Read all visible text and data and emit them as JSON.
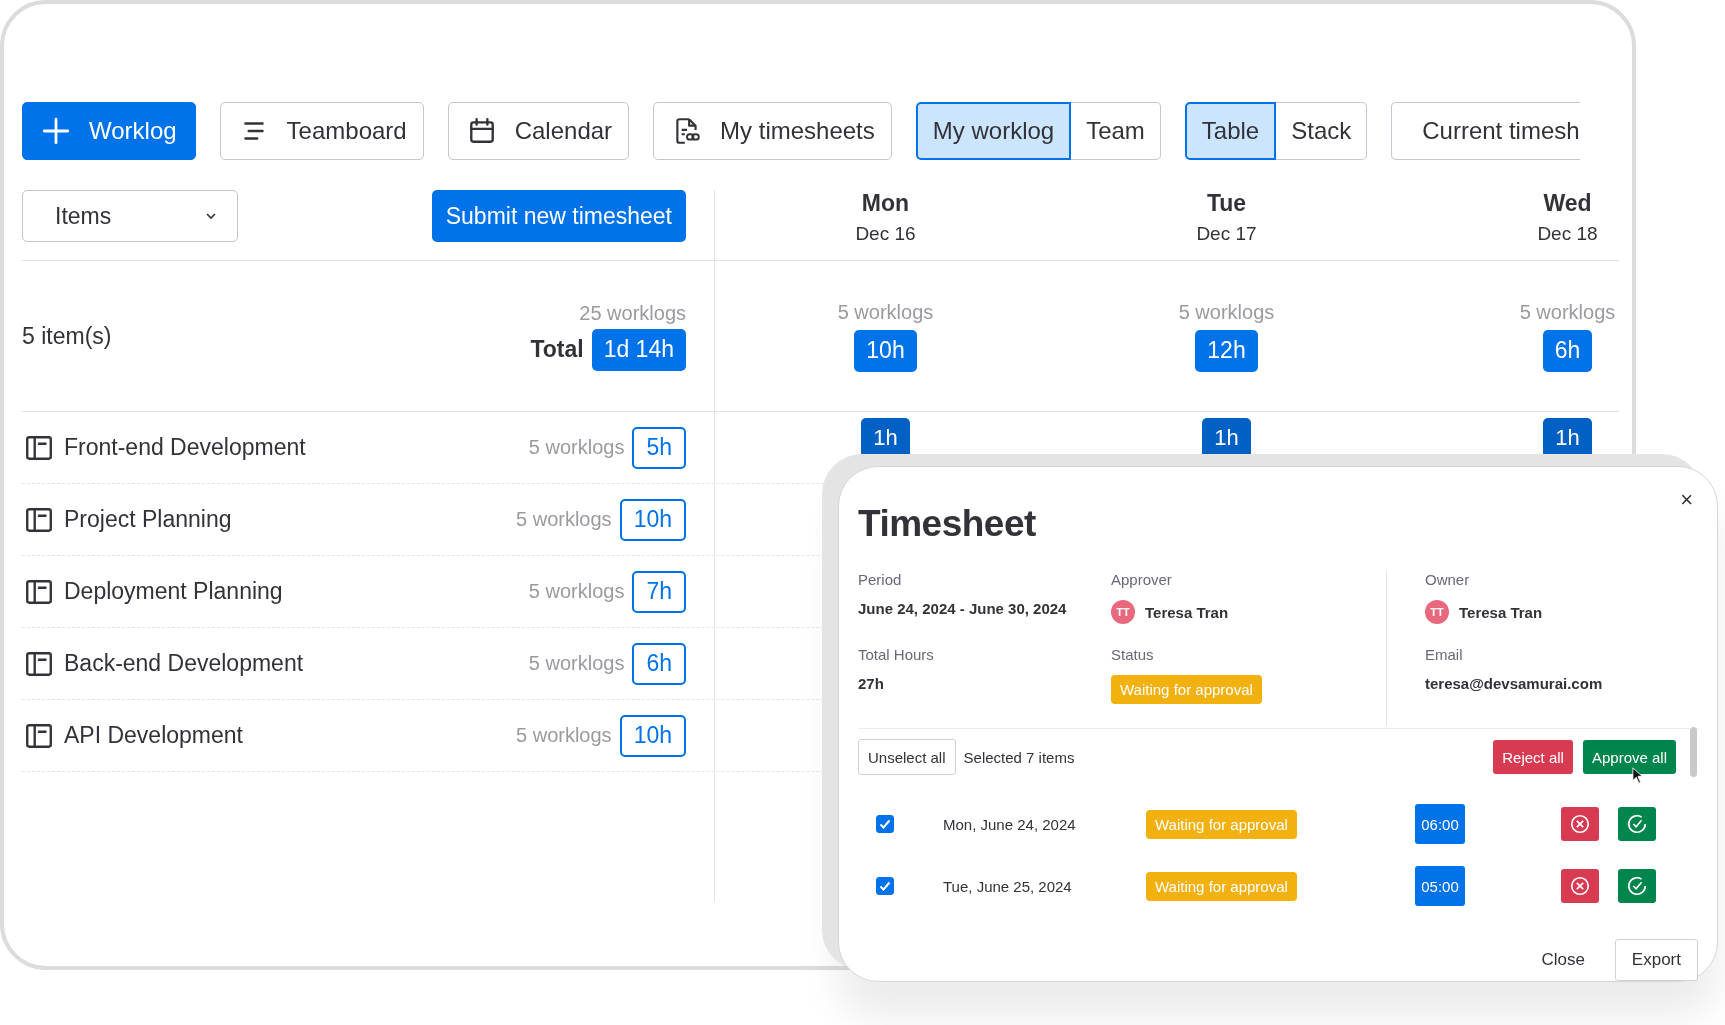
{
  "toolbar": {
    "buttons": [
      {
        "kind": "add",
        "label": "Worklog"
      },
      {
        "kind": "board",
        "label": "Teamboard"
      },
      {
        "kind": "calendar",
        "label": "Calendar"
      },
      {
        "kind": "sheets",
        "label": "My timesheets"
      }
    ],
    "scope_toggle": [
      {
        "label": "My worklog",
        "selected": true
      },
      {
        "label": "Team",
        "selected": false
      }
    ],
    "view_toggle": [
      {
        "label": "Table",
        "selected": true
      },
      {
        "label": "Stack",
        "selected": false
      }
    ],
    "period_button": "Current timesh"
  },
  "group_by": {
    "value": "Items"
  },
  "submit_button": "Submit new timesheet",
  "days": [
    {
      "day": "Mon",
      "date": "Dec 16",
      "worklogs": "5 worklogs",
      "total": "10h"
    },
    {
      "day": "Tue",
      "date": "Dec 17",
      "worklogs": "5 worklogs",
      "total": "12h"
    },
    {
      "day": "Wed",
      "date": "Dec 18",
      "worklogs": "5 worklogs",
      "total": "6h"
    }
  ],
  "summary": {
    "count": "5 item(s)",
    "worklogs": "25 worklogs",
    "total_label": "Total",
    "total": "1d 14h"
  },
  "items": [
    {
      "name": "Front-end Development",
      "worklogs": "5 worklogs",
      "hours": "5h",
      "day_hours": [
        "1h",
        "1h",
        "1h"
      ]
    },
    {
      "name": "Project Planning",
      "worklogs": "5 worklogs",
      "hours": "10h"
    },
    {
      "name": "Deployment Planning",
      "worklogs": "5 worklogs",
      "hours": "7h"
    },
    {
      "name": "Back-end Development",
      "worklogs": "5 worklogs",
      "hours": "6h"
    },
    {
      "name": "API Development",
      "worklogs": "5 worklogs",
      "hours": "10h"
    }
  ],
  "dialog": {
    "title": "Timesheet",
    "close": "×",
    "fields": [
      {
        "kind": "text",
        "label": "Period",
        "value": "June 24, 2024 - June 30, 2024"
      },
      {
        "kind": "person",
        "label": "Approver",
        "initials": "TT",
        "value": "Teresa Tran"
      },
      {
        "kind": "person",
        "label": "Owner",
        "initials": "TT",
        "value": "Teresa Tran"
      },
      {
        "kind": "text",
        "label": "Total Hours",
        "value": "27h"
      },
      {
        "kind": "badge",
        "label": "Status",
        "value": "Waiting for approval"
      },
      {
        "kind": "text",
        "label": "Email",
        "value": "teresa@devsamurai.com"
      }
    ],
    "bulk": {
      "unselect": "Unselect all",
      "selected_text": "Selected 7 items",
      "reject": "Reject all",
      "approve": "Approve all"
    },
    "entries": [
      {
        "checked": true,
        "date": "Mon, June 24, 2024",
        "status": "Waiting for approval",
        "hours": "06:00"
      },
      {
        "checked": true,
        "date": "Tue, June 25, 2024",
        "status": "Waiting for approval",
        "hours": "05:00"
      }
    ],
    "footer": {
      "close": "Close",
      "export": "Export"
    }
  }
}
